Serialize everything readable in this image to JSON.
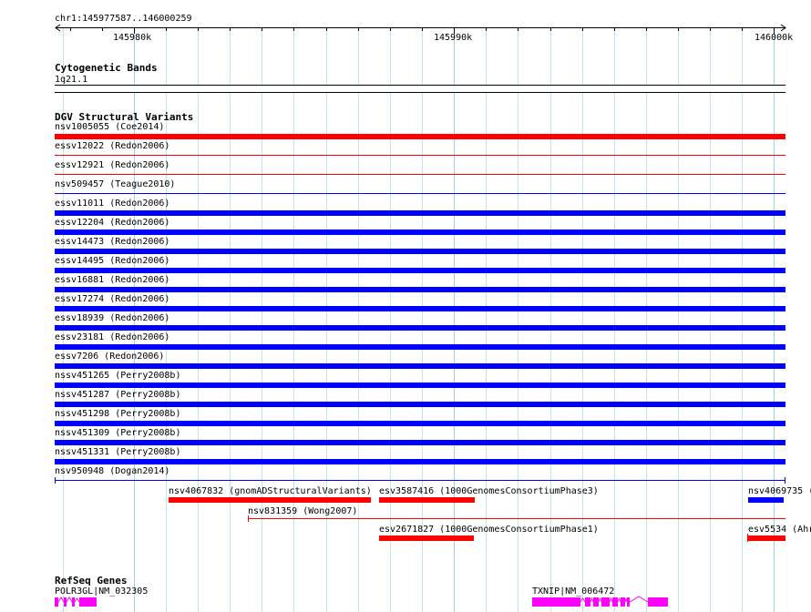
{
  "location": "chr1:145977587..146000259",
  "ruler": {
    "labels": [
      "145980k",
      "145990k",
      "146000k"
    ]
  },
  "cytoband": {
    "title": "Cytogenetic Bands",
    "band": "1q21.1"
  },
  "dgv": {
    "title": "DGV Structural Variants",
    "rows": [
      {
        "label": "nsv1005055 (Coe2014)",
        "color": "#ff0000",
        "style": "thick"
      },
      {
        "label": "essv12022 (Redon2006)",
        "color": "#ff0000",
        "style": "thin"
      },
      {
        "label": "essv12921 (Redon2006)",
        "color": "#ff0000",
        "style": "thin"
      },
      {
        "label": "nsv509457 (Teague2010)",
        "color": "#0000ff",
        "style": "thin"
      },
      {
        "label": "essv11011 (Redon2006)",
        "color": "#0000ff",
        "style": "thick"
      },
      {
        "label": "essv12204 (Redon2006)",
        "color": "#0000ff",
        "style": "thick"
      },
      {
        "label": "essv14473 (Redon2006)",
        "color": "#0000ff",
        "style": "thick"
      },
      {
        "label": "essv14495 (Redon2006)",
        "color": "#0000ff",
        "style": "thick"
      },
      {
        "label": "essv16881 (Redon2006)",
        "color": "#0000ff",
        "style": "thick"
      },
      {
        "label": "essv17274 (Redon2006)",
        "color": "#0000ff",
        "style": "thick"
      },
      {
        "label": "essv18939 (Redon2006)",
        "color": "#0000ff",
        "style": "thick"
      },
      {
        "label": "essv23181 (Redon2006)",
        "color": "#0000ff",
        "style": "thick"
      },
      {
        "label": "essv7206 (Redon2006)",
        "color": "#0000ff",
        "style": "thick"
      },
      {
        "label": "nssv451265 (Perry2008b)",
        "color": "#0000ff",
        "style": "thick"
      },
      {
        "label": "nssv451287 (Perry2008b)",
        "color": "#0000ff",
        "style": "thick"
      },
      {
        "label": "nssv451298 (Perry2008b)",
        "color": "#0000ff",
        "style": "thick"
      },
      {
        "label": "nssv451309 (Perry2008b)",
        "color": "#0000ff",
        "style": "thick"
      },
      {
        "label": "nssv451331 (Perry2008b)",
        "color": "#0000ff",
        "style": "thick"
      },
      {
        "label": "nsv950948 (Dogan2014)",
        "color": "#0000ff",
        "style": "thin-ends"
      }
    ],
    "extra": {
      "nsv4067832": "nsv4067832 (gnomADStructuralVariants)",
      "esv3587416": "esv3587416 (1000GenomesConsortiumPhase3)",
      "nsv4069735": "nsv4069735 (",
      "nsv831359": "nsv831359 (Wong2007)",
      "esv2671827": "esv2671827 (1000GenomesConsortiumPhase1)",
      "esv5534": "esv5534 (Ahr"
    }
  },
  "refseq": {
    "title": "RefSeq Genes",
    "genes": [
      "POLR3GL|NM_032305",
      "TXNIP|NM_006472"
    ]
  },
  "colors": {
    "gain": "#0000ff",
    "loss": "#ff0000",
    "gene": "#ff00ff",
    "grid": "#c3e3ee"
  }
}
